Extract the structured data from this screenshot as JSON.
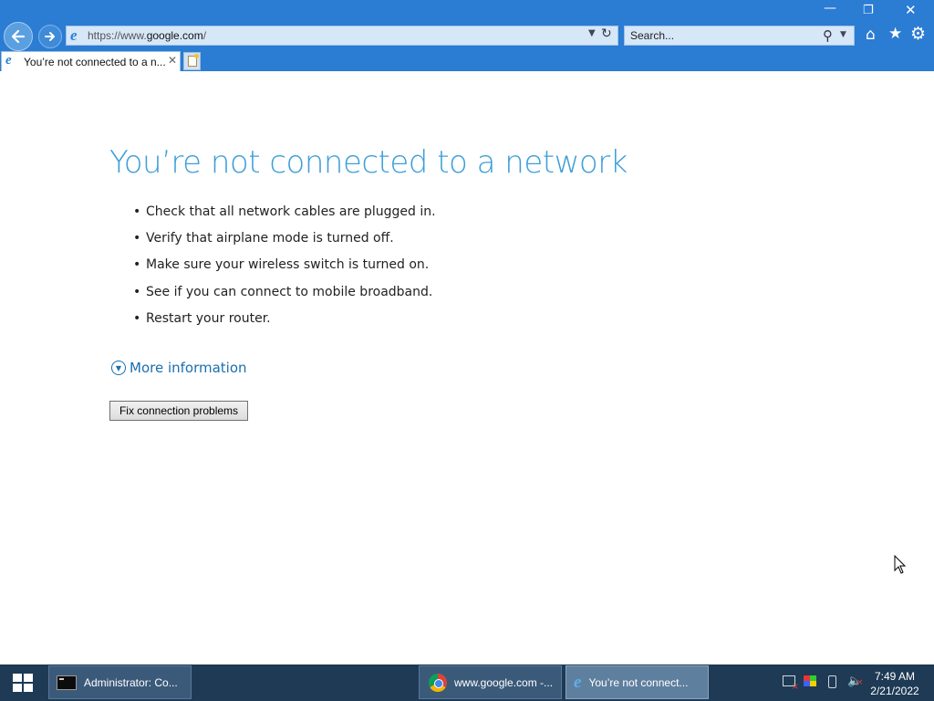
{
  "browser": {
    "address_prefix": "https://www.",
    "address_domain": "google.com",
    "address_suffix": "/",
    "search_placeholder": "Search...",
    "tab_title": "You’re not connected to a n..."
  },
  "page": {
    "title": "You’re not connected to a network",
    "tips": [
      "Check that all network cables are plugged in.",
      "Verify that airplane mode is turned off.",
      "Make sure your wireless switch is turned on.",
      "See if you can connect to mobile broadband.",
      "Restart your router."
    ],
    "more_info": "More information",
    "fix_button": "Fix connection problems"
  },
  "taskbar": {
    "items": [
      {
        "label": "Administrator: Co...",
        "icon": "cmd-icon"
      },
      {
        "label": "www.google.com -...",
        "icon": "chrome-icon"
      },
      {
        "label": "You’re not connect...",
        "icon": "ie-icon",
        "active": true
      }
    ],
    "time": "7:49 AM",
    "date": "2/21/2022"
  },
  "colors": {
    "title_blue": "#3c9ed9",
    "link_blue": "#1a6fae",
    "ie_chrome": "#2b7cd3",
    "taskbar": "#1e3a55"
  }
}
